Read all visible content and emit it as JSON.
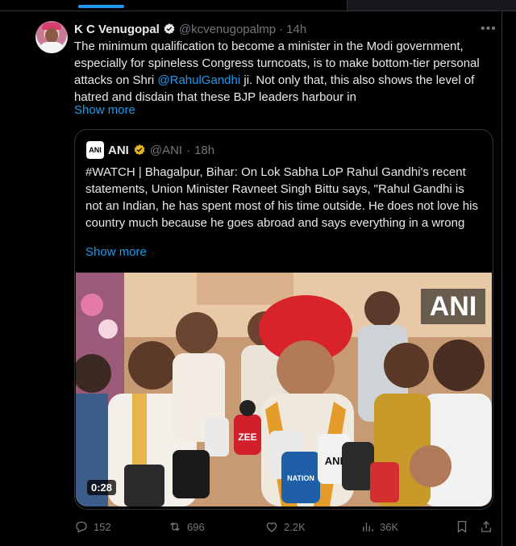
{
  "tweet": {
    "author_name": "K C Venugopal",
    "handle": "@kcvenugopalmp",
    "separator": "·",
    "time": "14h",
    "text_before_mention": "The minimum qualification to become a minister in the Modi government, especially for spineless Congress turncoats, is to make bottom-tier personal attacks on Shri ",
    "mention": "@RahulGandhi",
    "text_after_mention": " ji. Not only that, this also shows the level of hatred and disdain that these BJP leaders harbour in",
    "show_more": "Show more",
    "more_icon": "more-horizontal-icon",
    "verified_icon": "verified-badge-icon"
  },
  "quote": {
    "logo_text": "ANI",
    "author_name": "ANI",
    "handle": "@ANI",
    "separator": "·",
    "time": "18h",
    "text": "#WATCH | Bhagalpur, Bihar: On Lok Sabha LoP Rahul Gandhi's recent statements, Union Minister Ravneet Singh Bittu says, \"Rahul Gandhi is not an Indian, he has spent most of his time outside. He does not love his country much because he goes abroad and says everything in a wrong",
    "show_more": "Show more",
    "video": {
      "watermark": "ANI",
      "duration": "0:28",
      "mic_labels": [
        "ZEE",
        "ANI",
        "NATION"
      ]
    }
  },
  "actions": {
    "replies": "152",
    "reposts": "696",
    "likes": "2.2K",
    "views": "36K"
  },
  "colors": {
    "accent": "#1d9bf0",
    "muted": "#71767b",
    "border": "#2f3336",
    "verified_gold": "#e2b719"
  }
}
